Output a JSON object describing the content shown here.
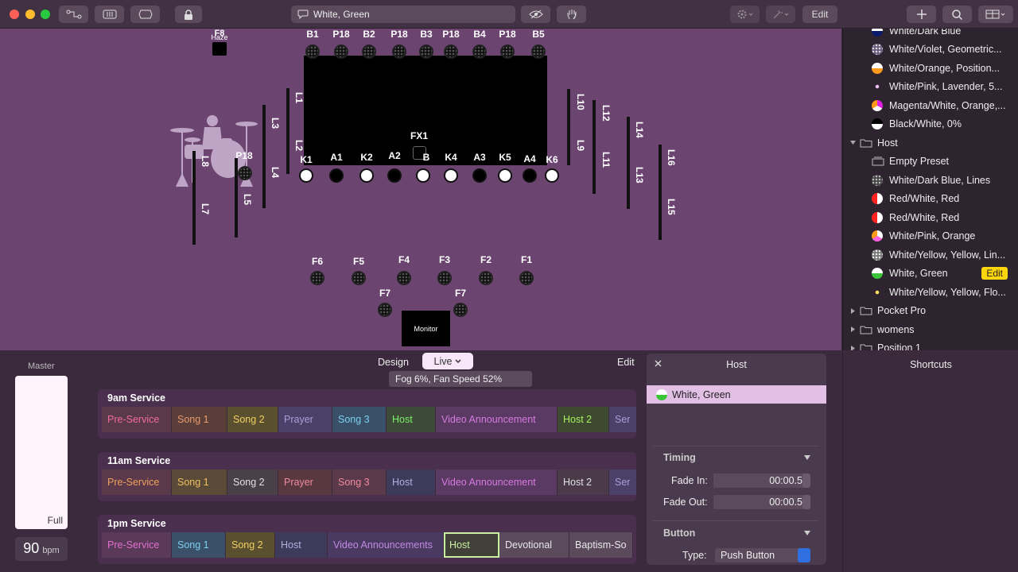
{
  "toolbar": {
    "title": "White, Green",
    "edit_label": "Edit",
    "traffic_colors": [
      "#ff5f57",
      "#febc2e",
      "#28c840"
    ]
  },
  "stage": {
    "haze_label": "Haze",
    "f8_label": "F8",
    "top_labels": [
      "B1",
      "P18",
      "B2",
      "P18",
      "B3",
      "P18",
      "B4",
      "P18",
      "B5"
    ],
    "fx1_label": "FX1",
    "front_labels": [
      "K1",
      "A1",
      "K2",
      "A2",
      "B",
      "K4",
      "A3",
      "K5",
      "A4",
      "K6"
    ],
    "p18_label": "P18",
    "bar_labels": {
      "L1": "L1",
      "L2": "L2",
      "L3": "L3",
      "L4": "L4",
      "L5": "L5",
      "L7": "L7",
      "L8": "L8",
      "L9": "L9",
      "L10": "L10",
      "L11": "L11",
      "L12": "L12",
      "L13": "L13",
      "L14": "L14",
      "L15": "L15",
      "L16": "L16"
    },
    "floor_labels": [
      "F6",
      "F5",
      "F4",
      "F3",
      "F2",
      "F1"
    ],
    "f7_labels": [
      "F7",
      "F7"
    ],
    "monitor_label": "Monitor"
  },
  "sidebar": {
    "items": [
      {
        "label": "White/Dark Blue",
        "icon": "color-swatch-icon"
      },
      {
        "label": "White/Violet, Geometric...",
        "icon": "pattern-icon"
      },
      {
        "label": "White/Orange, Position...",
        "icon": "color-swatch-icon"
      },
      {
        "label": "White/Pink, Lavender, 5...",
        "icon": "flower-icon"
      },
      {
        "label": "Magenta/White, Orange,...",
        "icon": "color-swatch-icon"
      },
      {
        "label": "Black/White, 0%",
        "icon": "color-swatch-icon"
      },
      {
        "label": "Host",
        "icon": "folder-icon"
      },
      {
        "label": "Empty Preset",
        "icon": "preset-icon"
      },
      {
        "label": "White/Dark Blue, Lines",
        "icon": "pattern-icon"
      },
      {
        "label": "Red/White, Red",
        "icon": "color-swatch-icon"
      },
      {
        "label": "Red/White, Red",
        "icon": "color-swatch-icon"
      },
      {
        "label": "White/Pink, Orange",
        "icon": "color-swatch-icon"
      },
      {
        "label": "White/Yellow, Yellow, Lin...",
        "icon": "pattern-icon"
      },
      {
        "label": "White, Green",
        "icon": "color-swatch-icon"
      },
      {
        "label": "White/Yellow, Yellow, Flo...",
        "icon": "flower-icon"
      },
      {
        "label": "Pocket Pro",
        "icon": "folder-icon"
      },
      {
        "label": "womens",
        "icon": "folder-icon"
      },
      {
        "label": "Position 1",
        "icon": "folder-icon"
      }
    ],
    "edit_label": "Edit"
  },
  "bottom": {
    "master_label": "Master",
    "full_label": "Full",
    "bpm_value": "90",
    "bpm_unit": "bpm",
    "design_label": "Design",
    "live_label": "Live",
    "edit_label": "Edit",
    "status": "Fog 6%, Fan Speed 52%",
    "services": [
      {
        "title": "9am Service",
        "cues": [
          "Pre-Service",
          "Song 1",
          "Song 2",
          "Prayer",
          "Song 3",
          "Host",
          "Video Announcement",
          "Host 2",
          "Ser"
        ]
      },
      {
        "title": "11am Service",
        "cues": [
          "Pre-Service",
          "Song 1",
          "Song 2",
          "Prayer",
          "Song 3",
          "Host",
          "Video Announcement",
          "Host 2",
          "Ser"
        ]
      },
      {
        "title": "1pm Service",
        "cues": [
          "Pre-Service",
          "Song 1",
          "Song 2",
          "Host",
          "Video Announcements",
          "Host",
          "Devotional",
          "Baptism-So"
        ]
      }
    ]
  },
  "inspector": {
    "title": "Host",
    "selected": "White, Green",
    "timing_label": "Timing",
    "fade_in_label": "Fade In:",
    "fade_in_value": "00:00.5",
    "fade_out_label": "Fade Out:",
    "fade_out_value": "00:00.5",
    "button_label": "Button",
    "type_label": "Type:",
    "type_value": "Push Button"
  },
  "shortcuts": {
    "title": "Shortcuts"
  }
}
